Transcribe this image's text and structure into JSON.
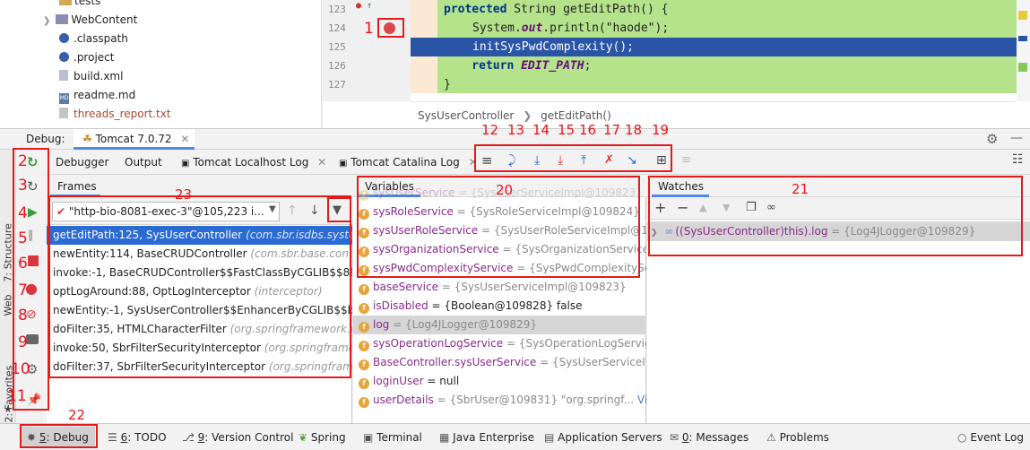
{
  "project_tree": {
    "items": [
      {
        "label": "tests",
        "type": "folder"
      },
      {
        "label": "WebContent",
        "type": "folder"
      },
      {
        "label": ".classpath",
        "type": "file"
      },
      {
        "label": ".project",
        "type": "file"
      },
      {
        "label": "build.xml",
        "type": "xml"
      },
      {
        "label": "readme.md",
        "type": "md"
      },
      {
        "label": "threads_report.txt",
        "type": "txt"
      }
    ]
  },
  "editor": {
    "lines": [
      {
        "num": "123",
        "kw": "protected",
        "rest": " String getEditPath() {"
      },
      {
        "num": "124",
        "pre": "    System.",
        "italic": "out",
        "post": ".println(\"haode\");"
      },
      {
        "num": "125",
        "code": "    initSysPwdComplexity();"
      },
      {
        "num": "126",
        "kw": "    return",
        "italic": " EDIT_PATH",
        "post": ";"
      },
      {
        "num": "127",
        "code": "}"
      }
    ],
    "breadcrumb": [
      "SysUserController",
      "getEditPath()"
    ]
  },
  "debug": {
    "label": "Debug:",
    "session": "Tomcat 7.0.72",
    "tabs": [
      "Debugger",
      "Output",
      "Tomcat Localhost Log",
      "Tomcat Catalina Log"
    ],
    "frames_title": "Frames",
    "thread": "\"http-bio-8081-exec-3\"@105,223 i...",
    "frames": [
      {
        "name": "getEditPath:125, SysUserController",
        "pkg": "(com.sbr.isdbs.system"
      },
      {
        "name": "newEntity:114, BaseCRUDController",
        "pkg": "(com.sbr.base.contro"
      },
      {
        "name": "invoke:-1, BaseCRUDController$$FastClassByCGLIB$$896",
        "pkg": ""
      },
      {
        "name": "optLogAround:88, OptLogInterceptor",
        "pkg": "(interceptor)"
      },
      {
        "name": "newEntity:-1, SysUserController$$EnhancerByCGLIB$$b2a",
        "pkg": ""
      },
      {
        "name": "doFilter:35, HTMLCharacterFilter",
        "pkg": "(org.springframework.w"
      },
      {
        "name": "invoke:50, SbrFilterSecurityInterceptor",
        "pkg": "(org.springframew"
      },
      {
        "name": "doFilter:37, SbrFilterSecurityInterceptor",
        "pkg": "(org.springframe"
      }
    ],
    "variables_title": "Variables",
    "variables": [
      {
        "name": "sysUserService",
        "val": "= {SysUserServiceImpl@109823}"
      },
      {
        "name": "sysRoleService",
        "val": "= {SysRoleServiceImpl@109824}"
      },
      {
        "name": "sysUserRoleService",
        "val": "= {SysUserRoleServiceImpl@109"
      },
      {
        "name": "sysOrganizationService",
        "val": "= {SysOrganizationServiceImp"
      },
      {
        "name": "sysPwdComplexityService",
        "val": "= {SysPwdComplexityServic"
      },
      {
        "name": "baseService",
        "val": "= {SysUserServiceImpl@109823}"
      },
      {
        "name": "isDisabled",
        "val": "= {Boolean@109828} false"
      },
      {
        "name": "log",
        "val": "= {Log4JLogger@109829}"
      },
      {
        "name": "sysOperationLogService",
        "val": "= {SysOperationLogServiceI"
      },
      {
        "name": "BaseController.sysUserService",
        "val": "= {SysUserServiceImp"
      },
      {
        "name": "loginUser",
        "val": "= null"
      },
      {
        "name": "userDetails",
        "val": "= {SbrUser@109831} \"org.springf...",
        "link": "View"
      }
    ],
    "watches_title": "Watches",
    "watch": {
      "expr": "((SysUserController)this).log",
      "val": "= {Log4JLogger@109829}"
    }
  },
  "side_labels": {
    "structure": "7: Structure",
    "web": "Web",
    "favorites": "2: Favorites"
  },
  "bottom_bar": [
    {
      "num": "5",
      "label": ": Debug"
    },
    {
      "num": "6",
      "label": ": TODO"
    },
    {
      "num": "9",
      "label": ": Version Control"
    },
    {
      "num": "",
      "label": "Spring"
    },
    {
      "num": "",
      "label": "Terminal"
    },
    {
      "num": "",
      "label": "Java Enterprise"
    },
    {
      "num": "",
      "label": "Application Servers"
    },
    {
      "num": "0",
      "label": ": Messages"
    },
    {
      "num": "",
      "label": "Problems"
    },
    {
      "num": "",
      "label": "Event Log"
    }
  ],
  "annotations": {
    "n1": "1",
    "n2": "2",
    "n3": "3",
    "n4": "4",
    "n5": "5",
    "n6": "6",
    "n7": "7",
    "n8": "8",
    "n9": "9",
    "n10": "10",
    "n11": "11",
    "n12": "12",
    "n13": "13",
    "n14": "14",
    "n15": "15",
    "n16": "16",
    "n17": "17",
    "n18": "18",
    "n19": "19",
    "n20": "20",
    "n21": "21",
    "n22": "22",
    "n23": "23"
  }
}
